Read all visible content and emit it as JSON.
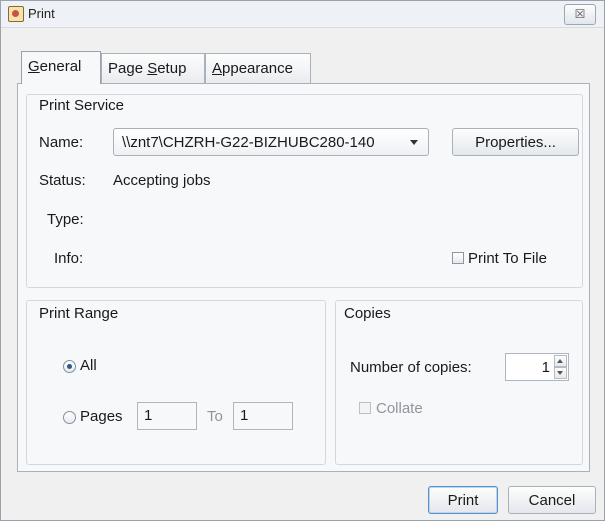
{
  "window": {
    "title": "Print",
    "close_symbol": "☒"
  },
  "tabs": [
    {
      "pre": "",
      "mnemonic": "G",
      "post": "eneral",
      "selected": true
    },
    {
      "pre": "Page ",
      "mnemonic": "S",
      "post": "etup",
      "selected": false
    },
    {
      "pre": "",
      "mnemonic": "A",
      "post": "ppearance",
      "selected": false
    }
  ],
  "print_service": {
    "title": "Print Service",
    "name_label": "Name:",
    "printer_name": "\\\\znt7\\CHZRH-G22-BIZHUBC280-140",
    "properties_button": "Properties...",
    "status_label": "Status:",
    "status_value": "Accepting jobs",
    "type_label": "Type:",
    "info_label": "Info:",
    "print_to_file_label": "Print To File"
  },
  "print_range": {
    "title": "Print Range",
    "all_label": "All",
    "pages_label": "Pages",
    "pages_from": "1",
    "to_label": "To",
    "pages_to": "1"
  },
  "copies": {
    "title": "Copies",
    "number_label": "Number of copies:",
    "number_value": "1",
    "collate_label": "Collate"
  },
  "footer": {
    "print_button": "Print",
    "cancel_button": "Cancel"
  }
}
